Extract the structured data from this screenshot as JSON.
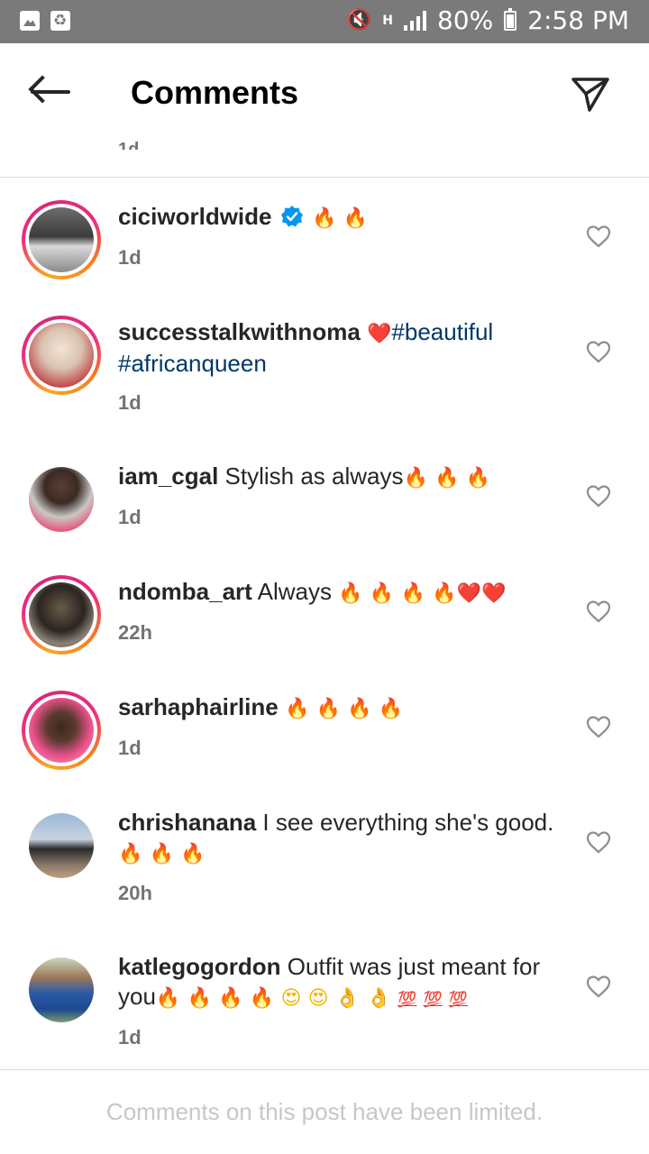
{
  "status_bar": {
    "battery": "80%",
    "time": "2:58 PM",
    "network": "H"
  },
  "header": {
    "title": "Comments"
  },
  "cutoff_text": "1d",
  "comments": [
    {
      "username": "ciciworldwide",
      "verified": true,
      "text": "",
      "emojis": [
        "🔥",
        "🔥"
      ],
      "time": "1d"
    },
    {
      "username": "successtalkwithnoma",
      "text": "",
      "emojis_before": [
        "❤️"
      ],
      "hashtags": [
        "#beautiful",
        "#africanqueen"
      ],
      "time": "1d"
    },
    {
      "username": "iam_cgal",
      "text": "Stylish as always",
      "emojis": [
        "🔥",
        "🔥",
        "🔥"
      ],
      "time": "1d"
    },
    {
      "username": "ndomba_art",
      "text": "Always",
      "emojis": [
        "🔥",
        "🔥",
        "🔥",
        "🔥",
        "❤️",
        "❤️"
      ],
      "time": "22h"
    },
    {
      "username": "sarhaphairline",
      "text": "",
      "emojis": [
        "🔥",
        "🔥",
        "🔥",
        "🔥"
      ],
      "time": "1d"
    },
    {
      "username": "chrishanana",
      "text": "I see everything she's good.",
      "emojis": [
        "🔥",
        "🔥",
        "🔥"
      ],
      "time": "20h"
    },
    {
      "username": "katlegogordon",
      "text": "Outfit was just meant for you",
      "emojis": [
        "🔥",
        "🔥",
        "🔥",
        "🔥",
        "😍",
        "😍",
        "👌",
        "👌",
        "💯",
        "💯",
        "💯"
      ],
      "time": "1d"
    }
  ],
  "footer": {
    "text": "Comments on this post have been limited."
  },
  "colors": {
    "status_bar": "#7a7a7a",
    "text": "#262626",
    "secondary": "#737373",
    "hashtag": "#00376b",
    "verified": "#0095f6",
    "divider": "#dbdbdb"
  }
}
